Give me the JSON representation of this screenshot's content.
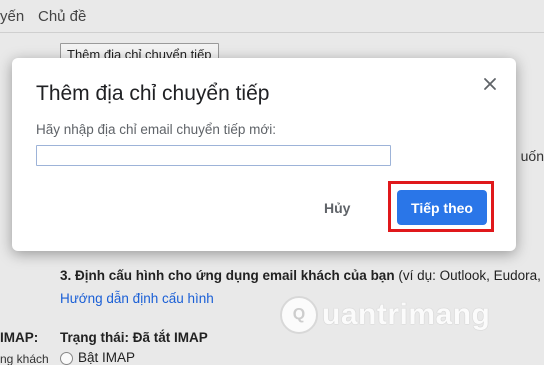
{
  "background": {
    "tab_partial": "yến",
    "tab_topics": "Chủ đề",
    "add_forward_button": "Thêm địa chỉ chuyển tiếp",
    "right_partial": "uốn",
    "step3_heading": "3. Định cấu hình cho ứng dụng email khách của bạn",
    "step3_note": " (ví dụ: Outlook, Eudora,",
    "guide_link": "Hướng dẫn định cấu hình",
    "imap_label": "IMAP:",
    "imap_status": "Trạng thái: Đã tắt IMAP",
    "left_partial": "ng khách",
    "enable_imap": "Bật IMAP"
  },
  "watermark": {
    "text": "uantrimang",
    "logo_letter": "Q"
  },
  "dialog": {
    "title": "Thêm địa chỉ chuyển tiếp",
    "prompt_label": "Hãy nhập địa chỉ email chuyển tiếp mới:",
    "email_input_value": "",
    "email_input_placeholder": "",
    "cancel_label": "Hủy",
    "next_label": "Tiếp theo",
    "close_icon": "close-icon"
  },
  "colors": {
    "primary_button": "#2a76e8",
    "highlight": "#e0181b",
    "link": "#1a5fd6"
  }
}
